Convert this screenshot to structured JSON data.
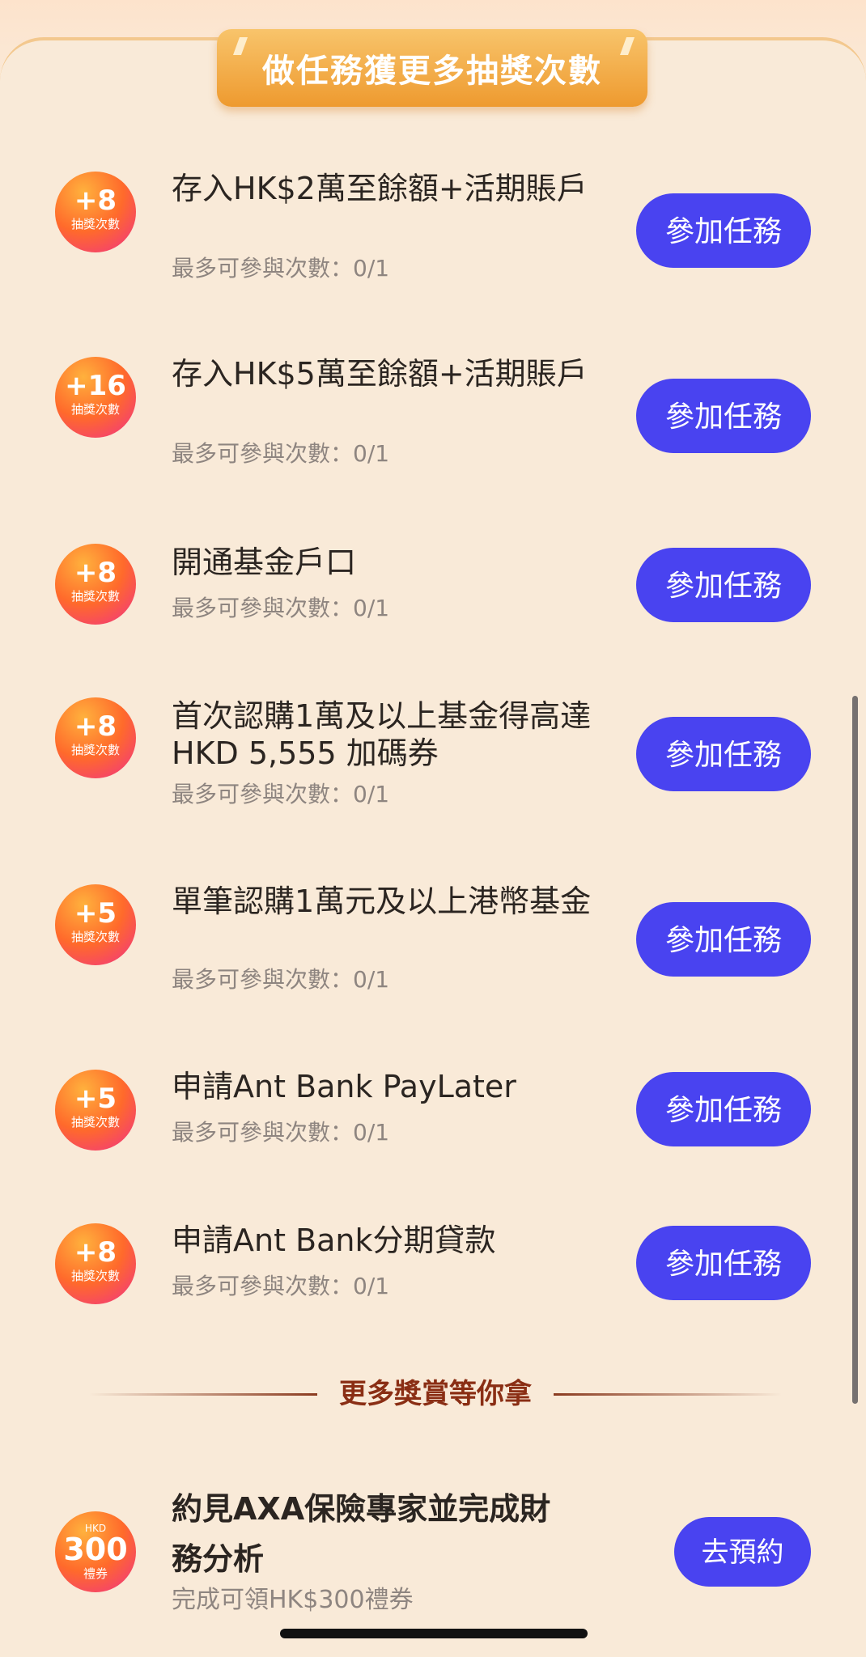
{
  "header": {
    "title": "做任務獲更多抽獎次數"
  },
  "tasks": [
    {
      "badge_value": "+8",
      "badge_label": "抽獎次數",
      "title": "存入HK$2萬至餘額+活期賬戶",
      "subtitle": "最多可參與次數：0/1",
      "button_label": "參加任務"
    },
    {
      "badge_value": "+16",
      "badge_label": "抽獎次數",
      "title": "存入HK$5萬至餘額+活期賬戶",
      "subtitle": "最多可參與次數：0/1",
      "button_label": "參加任務"
    },
    {
      "badge_value": "+8",
      "badge_label": "抽獎次數",
      "title": "開通基金戶口",
      "subtitle": "最多可參與次數：0/1",
      "button_label": "參加任務"
    },
    {
      "badge_value": "+8",
      "badge_label": "抽獎次數",
      "title": "首次認購1萬及以上基金得高達 HKD 5,555 加碼券",
      "subtitle": "最多可參與次數：0/1",
      "button_label": "參加任務"
    },
    {
      "badge_value": "+5",
      "badge_label": "抽獎次數",
      "title": "單筆認購1萬元及以上港幣基金",
      "subtitle": "最多可參與次數：0/1",
      "button_label": "參加任務"
    },
    {
      "badge_value": "+5",
      "badge_label": "抽獎次數",
      "title": "申請Ant Bank PayLater",
      "subtitle": "最多可參與次數：0/1",
      "button_label": "參加任務"
    },
    {
      "badge_value": "+8",
      "badge_label": "抽獎次數",
      "title": "申請Ant Bank分期貸款",
      "subtitle": "最多可參與次數：0/1",
      "button_label": "參加任務"
    }
  ],
  "divider": {
    "label": "更多獎賞等你拿"
  },
  "reward": {
    "badge_currency": "HKD",
    "badge_value": "300",
    "badge_label": "禮券",
    "title": "約見AXA保險專家並完成財務分析",
    "subtitle": "完成可領HK$300禮券",
    "button_label": "去預約"
  },
  "colors": {
    "background": "#f9ead8",
    "banner": "#ee9a2f",
    "button": "#4943f0",
    "badge_start": "#ff6a2b",
    "badge_end": "#f0308a",
    "divider_text": "#8a2e14"
  }
}
